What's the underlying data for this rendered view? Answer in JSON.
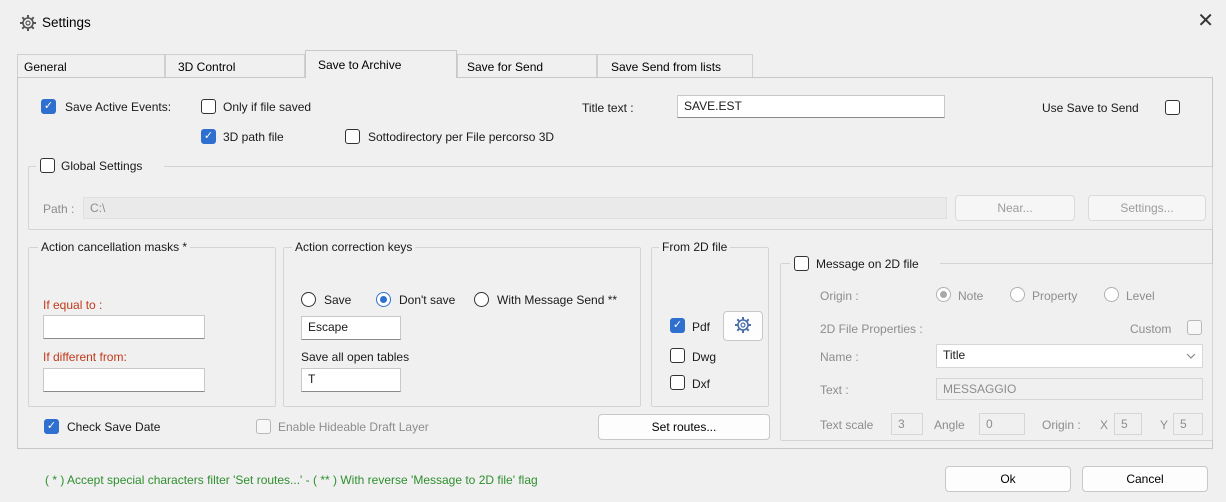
{
  "window": {
    "title": "Settings",
    "close_glyph": "✕"
  },
  "tabs": [
    "General",
    "3D Control",
    "Save to Archive",
    "Save for Send",
    "Save Send from lists"
  ],
  "top": {
    "save_active_events": "Save Active Events:",
    "only_if_file_saved": "Only if file saved",
    "path_3d_file": "3D path file",
    "sottodirectory": "Sottodirectory per File percorso 3D",
    "title_text_label": "Title text :",
    "title_text_value": "SAVE.EST",
    "use_save_to_send": "Use Save to Send"
  },
  "global_settings": {
    "label": "Global Settings",
    "path_label": "Path :",
    "path_value": "C:\\",
    "near_button": "Near...",
    "settings_button": "Settings..."
  },
  "masks": {
    "title": "Action cancellation masks *",
    "if_equal_label": "If equal to :",
    "if_equal_value": "",
    "if_different_label": "If different from:",
    "if_different_value": ""
  },
  "correction": {
    "title": "Action correction keys",
    "opt_save": "Save",
    "opt_dont_save": "Don't save",
    "opt_with_message": "With Message Send **",
    "key_value": "Escape",
    "save_all_label": "Save all open tables",
    "save_all_value": "T"
  },
  "from2d": {
    "title": "From 2D file",
    "pdf": "Pdf",
    "dwg": "Dwg",
    "dxf": "Dxf"
  },
  "message2d": {
    "title": "Message on 2D file",
    "origin_label": "Origin :",
    "opt_note": "Note",
    "opt_property": "Property",
    "opt_level": "Level",
    "file_props_label": "2D File Properties :",
    "custom_label": "Custom",
    "name_label": "Name :",
    "name_value": "Title",
    "text_label": "Text :",
    "text_value": "MESSAGGIO",
    "text_scale_label": "Text scale",
    "text_scale_value": "3",
    "angle_label": "Angle",
    "angle_value": "0",
    "origin2_label": "Origin :",
    "x_label": "X",
    "x_value": "5",
    "y_label": "Y",
    "y_value": "5"
  },
  "bottom": {
    "check_save_date": "Check Save Date",
    "enable_hideable": "Enable Hideable Draft Layer",
    "set_routes_button": "Set routes...",
    "footnote": "( * ) Accept special characters filter 'Set routes...' - ( ** ) With reverse 'Message to 2D file' flag",
    "ok_button": "Ok",
    "cancel_button": "Cancel"
  },
  "colors": {
    "accent": "#2f6fd0",
    "warn_label": "#c0391b",
    "footnote": "#2f8f2f"
  }
}
